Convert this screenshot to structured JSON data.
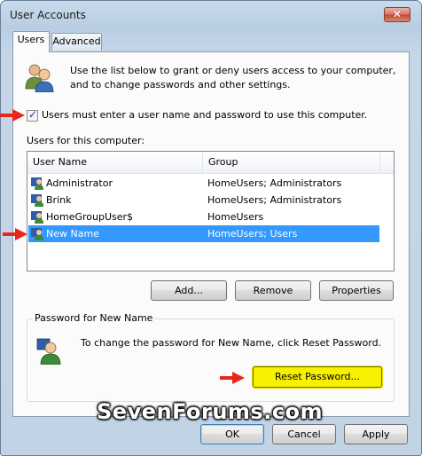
{
  "window": {
    "title": "User Accounts",
    "close_label": "✕"
  },
  "tabs": [
    {
      "label": "Users",
      "active": true
    },
    {
      "label": "Advanced",
      "active": false
    }
  ],
  "intro": {
    "line1": "Use the list below to grant or deny users access to your computer,",
    "line2": "and to change passwords and other settings."
  },
  "require_login": {
    "checked": true,
    "label": "Users must enter a user name and password to use this computer."
  },
  "users_list": {
    "label": "Users for this computer:",
    "columns": [
      "User Name",
      "Group"
    ],
    "rows": [
      {
        "name": "Administrator",
        "group": "HomeUsers; Administrators",
        "selected": false
      },
      {
        "name": "Brink",
        "group": "HomeUsers; Administrators",
        "selected": false
      },
      {
        "name": "HomeGroupUser$",
        "group": "HomeUsers",
        "selected": false
      },
      {
        "name": "New Name",
        "group": "HomeUsers; Users",
        "selected": true
      }
    ]
  },
  "list_buttons": {
    "add": "Add...",
    "remove": "Remove",
    "properties": "Properties"
  },
  "password_group": {
    "title": "Password for New Name",
    "text": "To change the password for New Name, click Reset Password.",
    "reset_button": "Reset Password..."
  },
  "dialog_buttons": {
    "ok": "OK",
    "cancel": "Cancel",
    "apply": "Apply"
  },
  "watermark": "SevenForums.com",
  "colors": {
    "annotation_arrow": "#e8261b",
    "selection": "#3399ff",
    "highlight": "#f7f000"
  }
}
